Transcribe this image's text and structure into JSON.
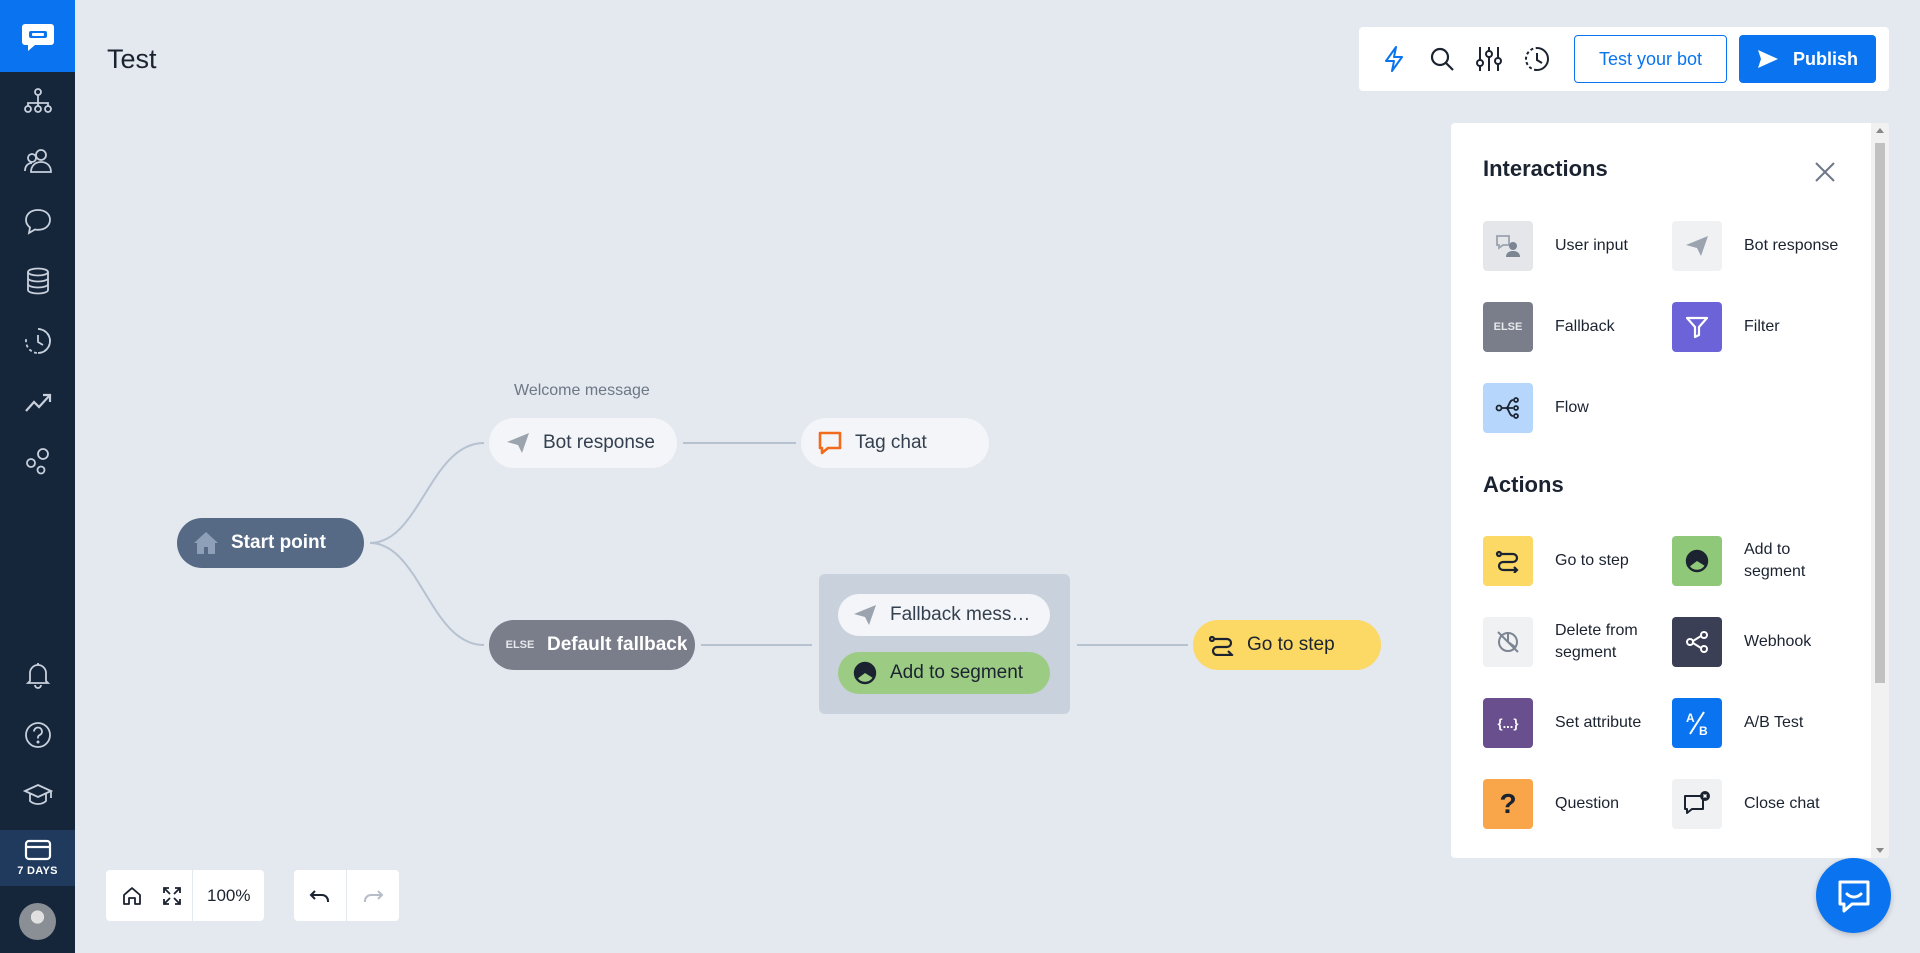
{
  "page": {
    "title": "Test"
  },
  "sidebar": {
    "items": [
      {
        "name": "bots-icon"
      },
      {
        "name": "audience-icon"
      },
      {
        "name": "chats-icon"
      },
      {
        "name": "data-icon"
      },
      {
        "name": "history-icon"
      },
      {
        "name": "reports-icon"
      },
      {
        "name": "integrations-icon"
      },
      {
        "name": "notifications-icon"
      },
      {
        "name": "help-icon"
      },
      {
        "name": "academy-icon"
      }
    ],
    "trial_label": "7 DAYS"
  },
  "toolbar": {
    "test_label": "Test your bot",
    "publish_label": "Publish"
  },
  "canvas": {
    "welcome_label": "Welcome message",
    "nodes": {
      "start": "Start point",
      "bot_response": "Bot response",
      "tag_chat": "Tag chat",
      "default_fallback": "Default fallback",
      "fallback_message": "Fallback mess…",
      "add_to_segment": "Add to segment",
      "go_to_step": "Go to step"
    },
    "else_badge": "ELSE"
  },
  "panel": {
    "interactions_title": "Interactions",
    "actions_title": "Actions",
    "interactions": [
      {
        "label": "User input",
        "icon": "user-input-icon",
        "color": "#e4e6ea"
      },
      {
        "label": "Bot response",
        "icon": "bot-response-icon",
        "color": "#f0f1f3"
      },
      {
        "label": "Fallback",
        "icon": "fallback-icon",
        "color": "#7a7e8b",
        "badge": "ELSE"
      },
      {
        "label": "Filter",
        "icon": "filter-icon",
        "color": "#6c63d8"
      },
      {
        "label": "Flow",
        "icon": "flow-icon",
        "color": "#b6d6fb"
      }
    ],
    "actions": [
      {
        "label": "Go to step",
        "icon": "go-to-step-icon",
        "color": "#fcd864"
      },
      {
        "label": "Add to segment",
        "icon": "add-segment-icon",
        "color": "#8fc878"
      },
      {
        "label": "Delete from segment",
        "icon": "delete-segment-icon",
        "color": "#f0f1f3"
      },
      {
        "label": "Webhook",
        "icon": "webhook-icon",
        "color": "#3a3f55"
      },
      {
        "label": "Set attribute",
        "icon": "set-attribute-icon",
        "color": "#6a4f8f",
        "badge": "{...}"
      },
      {
        "label": "A/B Test",
        "icon": "ab-test-icon",
        "color": "#0a74f0"
      },
      {
        "label": "Question",
        "icon": "question-icon",
        "color": "#f9a54a",
        "badge": "?"
      },
      {
        "label": "Close chat",
        "icon": "close-chat-icon",
        "color": "#f0f1f3"
      }
    ]
  },
  "bottom_controls": {
    "zoom": "100%"
  },
  "colors": {
    "accent": "#0a74f0",
    "sidebar": "#15253a",
    "canvas": "#e4e8ef",
    "start_node": "#566a86",
    "go_to_step": "#fcd864",
    "segment": "#9ccc84"
  }
}
